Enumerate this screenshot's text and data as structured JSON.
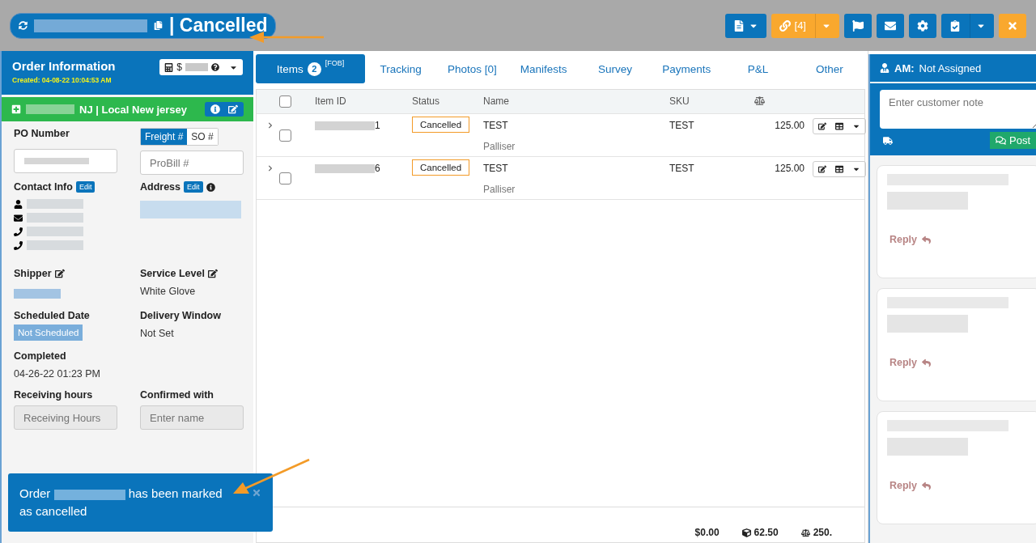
{
  "header": {
    "separator": "|",
    "status": "Cancelled"
  },
  "toolbar": [
    {
      "kind": "document",
      "color": "#0a74bb",
      "caret": true,
      "split": false
    },
    {
      "kind": "link",
      "color": "#f9a82e",
      "label": "[4]",
      "caret": true,
      "split": true
    },
    {
      "kind": "flag",
      "color": "#0a74bb",
      "caret": false,
      "split": false
    },
    {
      "kind": "mail",
      "color": "#0a74bb",
      "caret": false,
      "split": false
    },
    {
      "kind": "gear",
      "color": "#0a74bb",
      "caret": false,
      "split": false
    },
    {
      "kind": "checklist",
      "color": "#0a74bb",
      "caret": true,
      "split": true
    },
    {
      "kind": "close",
      "color": "#f9a82e",
      "caret": false,
      "split": false
    }
  ],
  "order_info": {
    "title": "Order Information",
    "created": "Created: 04-08-22 10:04:53 AM",
    "amount_prefix": "$",
    "location": "NJ | Local New jersey",
    "po_label": "PO Number",
    "freight_tabs": [
      {
        "label": "Freight #",
        "selected": true
      },
      {
        "label": "SO #",
        "selected": false
      }
    ],
    "probill_placeholder": "ProBill #",
    "contact_label": "Contact Info",
    "contact_edit": "Edit",
    "address_label": "Address",
    "address_edit": "Edit",
    "fields": [
      {
        "label": "Shipper",
        "editable": true,
        "kind": "redacted"
      },
      {
        "label": "Service Level",
        "editable": true,
        "value": "White Glove",
        "kind": "text"
      },
      {
        "label": "Scheduled Date",
        "editable": false,
        "value": "Not Scheduled",
        "kind": "badge"
      },
      {
        "label": "Delivery Window",
        "editable": false,
        "value": "Not Set",
        "kind": "text"
      },
      {
        "label": "Completed",
        "editable": false,
        "value": "04-26-22 01:23 PM",
        "kind": "wide"
      },
      {
        "label": "Receiving hours",
        "editable": false,
        "placeholder": "Receiving Hours",
        "kind": "input"
      },
      {
        "label": "Confirmed with",
        "editable": false,
        "placeholder": "Enter name",
        "kind": "input"
      }
    ]
  },
  "tabs": [
    {
      "label": "Items",
      "badge": "2",
      "sup": "[FOB]",
      "selected": true
    },
    {
      "label": "Tracking",
      "selected": false
    },
    {
      "label": "Photos [0]",
      "selected": false
    },
    {
      "label": "Manifests",
      "selected": false
    },
    {
      "label": "Survey",
      "selected": false
    },
    {
      "label": "Payments",
      "selected": false
    },
    {
      "label": "P&L",
      "selected": false
    },
    {
      "label": "Other",
      "selected": false
    }
  ],
  "table": {
    "all_checked": false,
    "columns": [
      "Item ID",
      "Status",
      "Name",
      "SKU"
    ],
    "rows": [
      {
        "id_suffix": "1",
        "status": "Cancelled",
        "name": "TEST",
        "sub": "Palliser",
        "sku": "TEST",
        "weight": "125.00",
        "checked": false
      },
      {
        "id_suffix": "6",
        "status": "Cancelled",
        "name": "TEST",
        "sub": "Palliser",
        "sku": "TEST",
        "weight": "125.00",
        "checked": false
      }
    ]
  },
  "totals": {
    "amount": "$0.00",
    "volume": "62.50",
    "weight": "250."
  },
  "notes": {
    "am_label": "AM:",
    "am_value": "Not Assigned",
    "placeholder": "Enter customer note",
    "post": "Post",
    "cards": [
      {
        "reply": "Reply"
      },
      {
        "reply": "Reply"
      },
      {
        "reply": "Reply"
      }
    ]
  },
  "toast": {
    "before": "Order",
    "after": "has been marked",
    "line2": "as cancelled"
  }
}
